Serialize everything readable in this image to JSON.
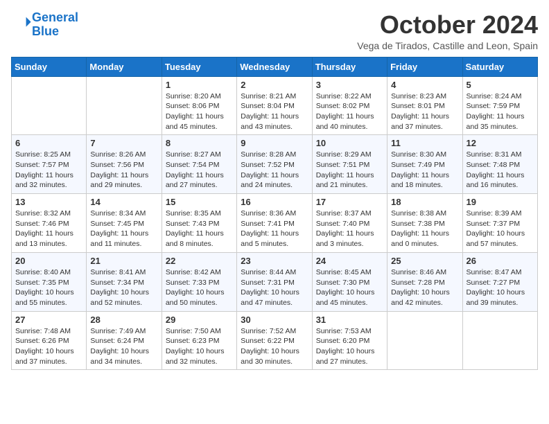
{
  "header": {
    "logo_line1": "General",
    "logo_line2": "Blue",
    "month": "October 2024",
    "location": "Vega de Tirados, Castille and Leon, Spain"
  },
  "weekdays": [
    "Sunday",
    "Monday",
    "Tuesday",
    "Wednesday",
    "Thursday",
    "Friday",
    "Saturday"
  ],
  "weeks": [
    [
      {
        "day": "",
        "info": ""
      },
      {
        "day": "",
        "info": ""
      },
      {
        "day": "1",
        "info": "Sunrise: 8:20 AM\nSunset: 8:06 PM\nDaylight: 11 hours and 45 minutes."
      },
      {
        "day": "2",
        "info": "Sunrise: 8:21 AM\nSunset: 8:04 PM\nDaylight: 11 hours and 43 minutes."
      },
      {
        "day": "3",
        "info": "Sunrise: 8:22 AM\nSunset: 8:02 PM\nDaylight: 11 hours and 40 minutes."
      },
      {
        "day": "4",
        "info": "Sunrise: 8:23 AM\nSunset: 8:01 PM\nDaylight: 11 hours and 37 minutes."
      },
      {
        "day": "5",
        "info": "Sunrise: 8:24 AM\nSunset: 7:59 PM\nDaylight: 11 hours and 35 minutes."
      }
    ],
    [
      {
        "day": "6",
        "info": "Sunrise: 8:25 AM\nSunset: 7:57 PM\nDaylight: 11 hours and 32 minutes."
      },
      {
        "day": "7",
        "info": "Sunrise: 8:26 AM\nSunset: 7:56 PM\nDaylight: 11 hours and 29 minutes."
      },
      {
        "day": "8",
        "info": "Sunrise: 8:27 AM\nSunset: 7:54 PM\nDaylight: 11 hours and 27 minutes."
      },
      {
        "day": "9",
        "info": "Sunrise: 8:28 AM\nSunset: 7:52 PM\nDaylight: 11 hours and 24 minutes."
      },
      {
        "day": "10",
        "info": "Sunrise: 8:29 AM\nSunset: 7:51 PM\nDaylight: 11 hours and 21 minutes."
      },
      {
        "day": "11",
        "info": "Sunrise: 8:30 AM\nSunset: 7:49 PM\nDaylight: 11 hours and 18 minutes."
      },
      {
        "day": "12",
        "info": "Sunrise: 8:31 AM\nSunset: 7:48 PM\nDaylight: 11 hours and 16 minutes."
      }
    ],
    [
      {
        "day": "13",
        "info": "Sunrise: 8:32 AM\nSunset: 7:46 PM\nDaylight: 11 hours and 13 minutes."
      },
      {
        "day": "14",
        "info": "Sunrise: 8:34 AM\nSunset: 7:45 PM\nDaylight: 11 hours and 11 minutes."
      },
      {
        "day": "15",
        "info": "Sunrise: 8:35 AM\nSunset: 7:43 PM\nDaylight: 11 hours and 8 minutes."
      },
      {
        "day": "16",
        "info": "Sunrise: 8:36 AM\nSunset: 7:41 PM\nDaylight: 11 hours and 5 minutes."
      },
      {
        "day": "17",
        "info": "Sunrise: 8:37 AM\nSunset: 7:40 PM\nDaylight: 11 hours and 3 minutes."
      },
      {
        "day": "18",
        "info": "Sunrise: 8:38 AM\nSunset: 7:38 PM\nDaylight: 11 hours and 0 minutes."
      },
      {
        "day": "19",
        "info": "Sunrise: 8:39 AM\nSunset: 7:37 PM\nDaylight: 10 hours and 57 minutes."
      }
    ],
    [
      {
        "day": "20",
        "info": "Sunrise: 8:40 AM\nSunset: 7:35 PM\nDaylight: 10 hours and 55 minutes."
      },
      {
        "day": "21",
        "info": "Sunrise: 8:41 AM\nSunset: 7:34 PM\nDaylight: 10 hours and 52 minutes."
      },
      {
        "day": "22",
        "info": "Sunrise: 8:42 AM\nSunset: 7:33 PM\nDaylight: 10 hours and 50 minutes."
      },
      {
        "day": "23",
        "info": "Sunrise: 8:44 AM\nSunset: 7:31 PM\nDaylight: 10 hours and 47 minutes."
      },
      {
        "day": "24",
        "info": "Sunrise: 8:45 AM\nSunset: 7:30 PM\nDaylight: 10 hours and 45 minutes."
      },
      {
        "day": "25",
        "info": "Sunrise: 8:46 AM\nSunset: 7:28 PM\nDaylight: 10 hours and 42 minutes."
      },
      {
        "day": "26",
        "info": "Sunrise: 8:47 AM\nSunset: 7:27 PM\nDaylight: 10 hours and 39 minutes."
      }
    ],
    [
      {
        "day": "27",
        "info": "Sunrise: 7:48 AM\nSunset: 6:26 PM\nDaylight: 10 hours and 37 minutes."
      },
      {
        "day": "28",
        "info": "Sunrise: 7:49 AM\nSunset: 6:24 PM\nDaylight: 10 hours and 34 minutes."
      },
      {
        "day": "29",
        "info": "Sunrise: 7:50 AM\nSunset: 6:23 PM\nDaylight: 10 hours and 32 minutes."
      },
      {
        "day": "30",
        "info": "Sunrise: 7:52 AM\nSunset: 6:22 PM\nDaylight: 10 hours and 30 minutes."
      },
      {
        "day": "31",
        "info": "Sunrise: 7:53 AM\nSunset: 6:20 PM\nDaylight: 10 hours and 27 minutes."
      },
      {
        "day": "",
        "info": ""
      },
      {
        "day": "",
        "info": ""
      }
    ]
  ]
}
